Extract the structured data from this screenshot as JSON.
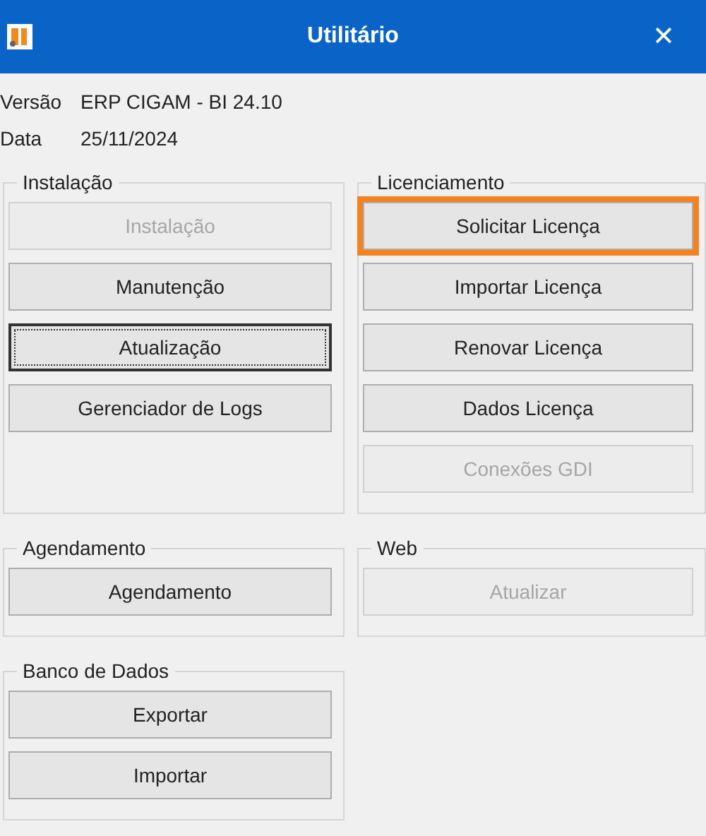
{
  "window": {
    "title": "Utilitário",
    "close": "✕"
  },
  "info": [
    {
      "label": "Versão",
      "value": "ERP CIGAM - BI 24.10"
    },
    {
      "label": "Data",
      "value": "25/11/2024"
    }
  ],
  "left_column": [
    {
      "title": "Instalação",
      "buttons": [
        {
          "label": "Instalação",
          "disabled": true,
          "focused": false,
          "highlighted": false
        },
        {
          "label": "Manutenção",
          "disabled": false,
          "focused": false,
          "highlighted": false
        },
        {
          "label": "Atualização",
          "disabled": false,
          "focused": true,
          "highlighted": false
        },
        {
          "label": "Gerenciador de Logs",
          "disabled": false,
          "focused": false,
          "highlighted": false
        }
      ]
    },
    {
      "title": "Agendamento",
      "buttons": [
        {
          "label": "Agendamento",
          "disabled": false,
          "focused": false,
          "highlighted": false
        }
      ]
    },
    {
      "title": "Banco de Dados",
      "buttons": [
        {
          "label": "Exportar",
          "disabled": false,
          "focused": false,
          "highlighted": false
        },
        {
          "label": "Importar",
          "disabled": false,
          "focused": false,
          "highlighted": false
        }
      ]
    }
  ],
  "right_column": [
    {
      "title": "Licenciamento",
      "buttons": [
        {
          "label": "Solicitar Licença",
          "disabled": false,
          "focused": false,
          "highlighted": true
        },
        {
          "label": "Importar Licença",
          "disabled": false,
          "focused": false,
          "highlighted": false
        },
        {
          "label": "Renovar Licença",
          "disabled": false,
          "focused": false,
          "highlighted": false
        },
        {
          "label": "Dados Licença",
          "disabled": false,
          "focused": false,
          "highlighted": false
        },
        {
          "label": "Conexões GDI",
          "disabled": true,
          "focused": false,
          "highlighted": false
        }
      ]
    },
    {
      "title": "Web",
      "buttons": [
        {
          "label": "Atualizar",
          "disabled": true,
          "focused": false,
          "highlighted": false
        }
      ]
    }
  ]
}
